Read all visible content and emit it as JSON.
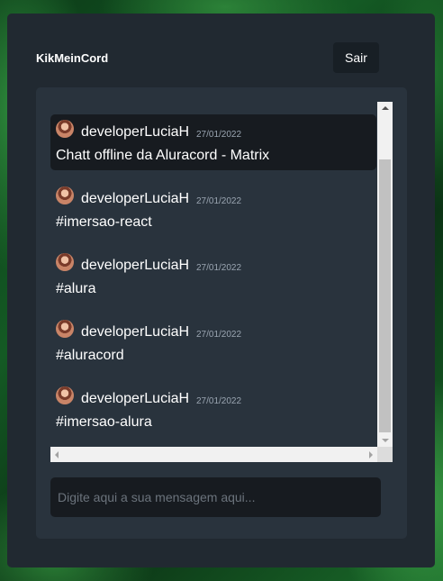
{
  "app": {
    "title": "KikMeinCord",
    "logout_label": "Sair"
  },
  "messages": [
    {
      "username": "developerLuciaH",
      "date": "27/01/2022",
      "text": "Chatt offline da Aluracord - Matrix"
    },
    {
      "username": "developerLuciaH",
      "date": "27/01/2022",
      "text": "#imersao-react"
    },
    {
      "username": "developerLuciaH",
      "date": "27/01/2022",
      "text": "#alura"
    },
    {
      "username": "developerLuciaH",
      "date": "27/01/2022",
      "text": "#aluracord"
    },
    {
      "username": "developerLuciaH",
      "date": "27/01/2022",
      "text": "#imersao-alura"
    }
  ],
  "composer": {
    "placeholder": "Digite aqui a sua mensagem aqui..."
  },
  "icons": {
    "avatar": "user-avatar-photo"
  },
  "colors": {
    "panel": "#212931",
    "chat_box": "#29333d",
    "input": "#171b20",
    "accent_bg": "#181f25"
  }
}
